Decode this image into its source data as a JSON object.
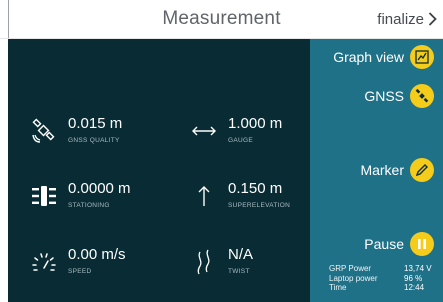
{
  "header": {
    "title": "Measurement",
    "finalize_label": "finalize"
  },
  "metrics": [
    {
      "value": "0.015 m",
      "label": "GNSS QUALITY",
      "icon": "satellite-icon"
    },
    {
      "value": "1.000 m",
      "label": "GAUGE",
      "icon": "double-arrow-icon"
    },
    {
      "value": "0.0000 m",
      "label": "STATIONING",
      "icon": "stationing-icon"
    },
    {
      "value": "0.150 m",
      "label": "SUPERELEVATION",
      "icon": "up-arrow-icon"
    },
    {
      "value": "0.00 m/s",
      "label": "SPEED",
      "icon": "speedometer-icon"
    },
    {
      "value": "N/A",
      "label": "TWIST",
      "icon": "twist-icon"
    }
  ],
  "side": {
    "graph_view_label": "Graph view",
    "gnss_label": "GNSS",
    "marker_label": "Marker",
    "pause_label": "Pause"
  },
  "status": [
    {
      "key": "GRP Power",
      "value": "13,74 V"
    },
    {
      "key": "Laptop power",
      "value": "96 %"
    },
    {
      "key": "Time",
      "value": "12:44"
    }
  ],
  "colors": {
    "main_bg": "#092b34",
    "side_bg": "#1f7188",
    "accent": "#f6cc1b"
  }
}
